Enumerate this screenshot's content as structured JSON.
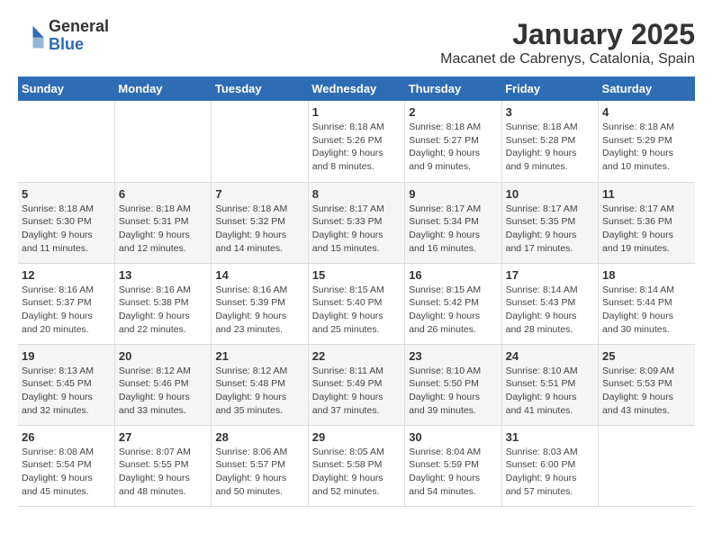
{
  "logo": {
    "general": "General",
    "blue": "Blue"
  },
  "title": "January 2025",
  "subtitle": "Macanet de Cabrenys, Catalonia, Spain",
  "days_of_week": [
    "Sunday",
    "Monday",
    "Tuesday",
    "Wednesday",
    "Thursday",
    "Friday",
    "Saturday"
  ],
  "weeks": [
    [
      {
        "day": "",
        "info": ""
      },
      {
        "day": "",
        "info": ""
      },
      {
        "day": "",
        "info": ""
      },
      {
        "day": "1",
        "info": "Sunrise: 8:18 AM\nSunset: 5:26 PM\nDaylight: 9 hours and 8 minutes."
      },
      {
        "day": "2",
        "info": "Sunrise: 8:18 AM\nSunset: 5:27 PM\nDaylight: 9 hours and 9 minutes."
      },
      {
        "day": "3",
        "info": "Sunrise: 8:18 AM\nSunset: 5:28 PM\nDaylight: 9 hours and 9 minutes."
      },
      {
        "day": "4",
        "info": "Sunrise: 8:18 AM\nSunset: 5:29 PM\nDaylight: 9 hours and 10 minutes."
      }
    ],
    [
      {
        "day": "5",
        "info": "Sunrise: 8:18 AM\nSunset: 5:30 PM\nDaylight: 9 hours and 11 minutes."
      },
      {
        "day": "6",
        "info": "Sunrise: 8:18 AM\nSunset: 5:31 PM\nDaylight: 9 hours and 12 minutes."
      },
      {
        "day": "7",
        "info": "Sunrise: 8:18 AM\nSunset: 5:32 PM\nDaylight: 9 hours and 14 minutes."
      },
      {
        "day": "8",
        "info": "Sunrise: 8:17 AM\nSunset: 5:33 PM\nDaylight: 9 hours and 15 minutes."
      },
      {
        "day": "9",
        "info": "Sunrise: 8:17 AM\nSunset: 5:34 PM\nDaylight: 9 hours and 16 minutes."
      },
      {
        "day": "10",
        "info": "Sunrise: 8:17 AM\nSunset: 5:35 PM\nDaylight: 9 hours and 17 minutes."
      },
      {
        "day": "11",
        "info": "Sunrise: 8:17 AM\nSunset: 5:36 PM\nDaylight: 9 hours and 19 minutes."
      }
    ],
    [
      {
        "day": "12",
        "info": "Sunrise: 8:16 AM\nSunset: 5:37 PM\nDaylight: 9 hours and 20 minutes."
      },
      {
        "day": "13",
        "info": "Sunrise: 8:16 AM\nSunset: 5:38 PM\nDaylight: 9 hours and 22 minutes."
      },
      {
        "day": "14",
        "info": "Sunrise: 8:16 AM\nSunset: 5:39 PM\nDaylight: 9 hours and 23 minutes."
      },
      {
        "day": "15",
        "info": "Sunrise: 8:15 AM\nSunset: 5:40 PM\nDaylight: 9 hours and 25 minutes."
      },
      {
        "day": "16",
        "info": "Sunrise: 8:15 AM\nSunset: 5:42 PM\nDaylight: 9 hours and 26 minutes."
      },
      {
        "day": "17",
        "info": "Sunrise: 8:14 AM\nSunset: 5:43 PM\nDaylight: 9 hours and 28 minutes."
      },
      {
        "day": "18",
        "info": "Sunrise: 8:14 AM\nSunset: 5:44 PM\nDaylight: 9 hours and 30 minutes."
      }
    ],
    [
      {
        "day": "19",
        "info": "Sunrise: 8:13 AM\nSunset: 5:45 PM\nDaylight: 9 hours and 32 minutes."
      },
      {
        "day": "20",
        "info": "Sunrise: 8:12 AM\nSunset: 5:46 PM\nDaylight: 9 hours and 33 minutes."
      },
      {
        "day": "21",
        "info": "Sunrise: 8:12 AM\nSunset: 5:48 PM\nDaylight: 9 hours and 35 minutes."
      },
      {
        "day": "22",
        "info": "Sunrise: 8:11 AM\nSunset: 5:49 PM\nDaylight: 9 hours and 37 minutes."
      },
      {
        "day": "23",
        "info": "Sunrise: 8:10 AM\nSunset: 5:50 PM\nDaylight: 9 hours and 39 minutes."
      },
      {
        "day": "24",
        "info": "Sunrise: 8:10 AM\nSunset: 5:51 PM\nDaylight: 9 hours and 41 minutes."
      },
      {
        "day": "25",
        "info": "Sunrise: 8:09 AM\nSunset: 5:53 PM\nDaylight: 9 hours and 43 minutes."
      }
    ],
    [
      {
        "day": "26",
        "info": "Sunrise: 8:08 AM\nSunset: 5:54 PM\nDaylight: 9 hours and 45 minutes."
      },
      {
        "day": "27",
        "info": "Sunrise: 8:07 AM\nSunset: 5:55 PM\nDaylight: 9 hours and 48 minutes."
      },
      {
        "day": "28",
        "info": "Sunrise: 8:06 AM\nSunset: 5:57 PM\nDaylight: 9 hours and 50 minutes."
      },
      {
        "day": "29",
        "info": "Sunrise: 8:05 AM\nSunset: 5:58 PM\nDaylight: 9 hours and 52 minutes."
      },
      {
        "day": "30",
        "info": "Sunrise: 8:04 AM\nSunset: 5:59 PM\nDaylight: 9 hours and 54 minutes."
      },
      {
        "day": "31",
        "info": "Sunrise: 8:03 AM\nSunset: 6:00 PM\nDaylight: 9 hours and 57 minutes."
      },
      {
        "day": "",
        "info": ""
      }
    ]
  ]
}
